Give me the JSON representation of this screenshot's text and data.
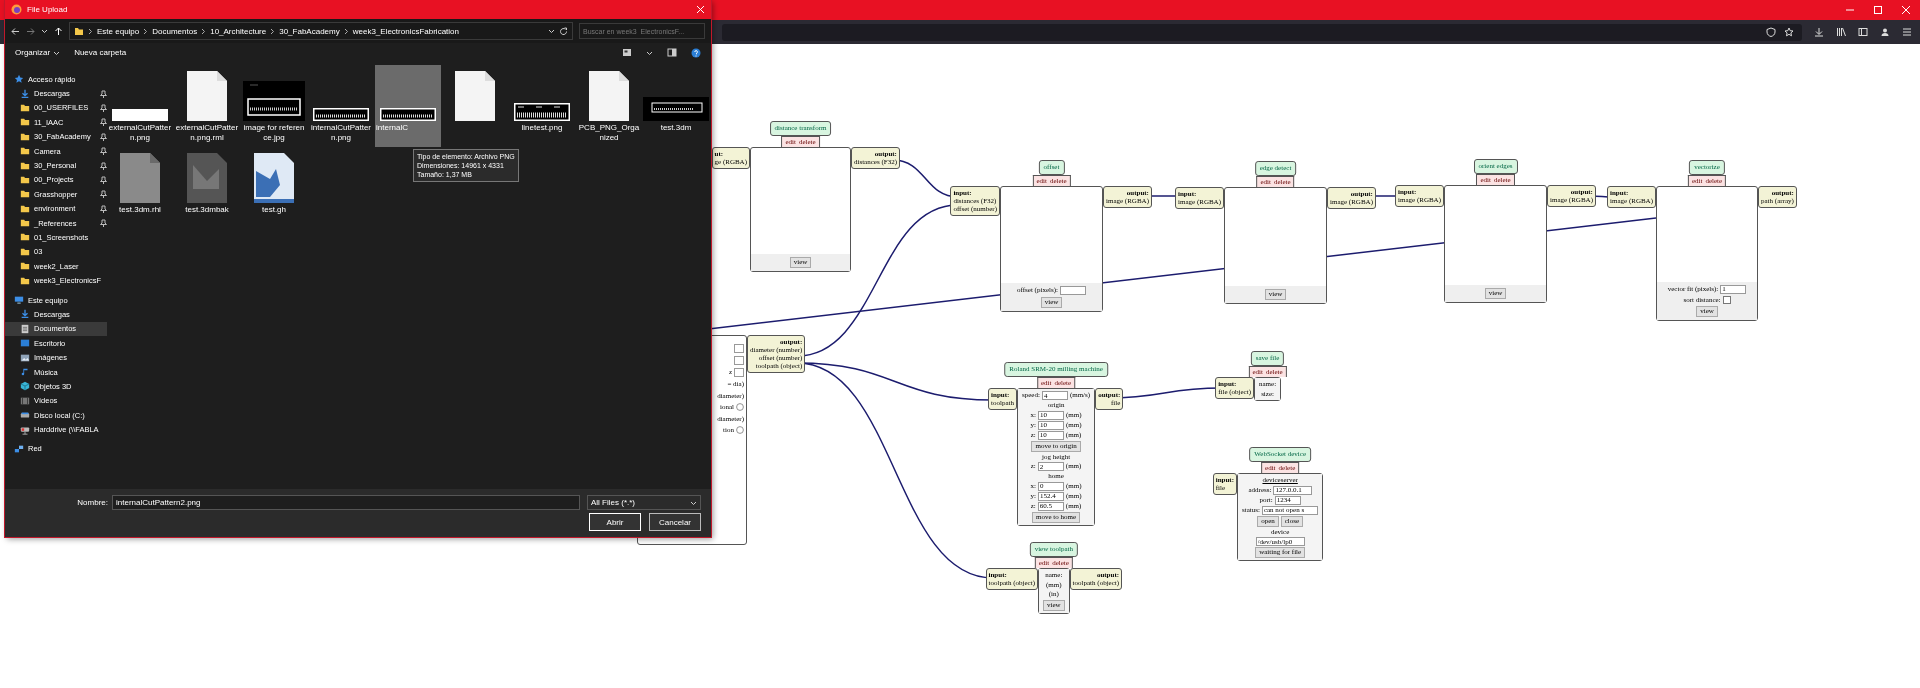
{
  "dialog": {
    "title": "File Upload",
    "breadcrumbs": [
      "Este equipo",
      "Documentos",
      "10_Architecture",
      "30_FabAcademy",
      "week3_ElectronicsFabrication"
    ],
    "search": {
      "placeholder": "Buscar en week3_ElectronicsF..."
    },
    "toolbar": {
      "organize": "Organizar",
      "new_folder": "Nueva carpeta"
    },
    "sidebar": [
      {
        "label": "Acceso rápido",
        "kind": "star",
        "selected": false,
        "items": [
          {
            "label": "Descargas",
            "kind": "download",
            "pinned": true,
            "selected": false
          },
          {
            "label": "00_USERFILES",
            "kind": "folder",
            "pinned": true,
            "selected": false
          },
          {
            "label": "11_IAAC",
            "kind": "folder",
            "pinned": true,
            "selected": false
          },
          {
            "label": "30_FabAcademy",
            "kind": "folder",
            "pinned": true,
            "selected": false
          },
          {
            "label": "Camera",
            "kind": "folder",
            "pinned": true,
            "selected": false
          },
          {
            "label": "30_Personal",
            "kind": "folder",
            "pinned": true,
            "selected": false
          },
          {
            "label": "00_Projects",
            "kind": "folder",
            "pinned": true,
            "selected": false
          },
          {
            "label": "Grasshopper",
            "kind": "folder",
            "pinned": true,
            "selected": false
          },
          {
            "label": "environment",
            "kind": "folder",
            "pinned": true,
            "selected": false
          },
          {
            "label": "_References",
            "kind": "folder",
            "pinned": true,
            "selected": false
          },
          {
            "label": "01_Screenshots",
            "kind": "folder",
            "pinned": false,
            "selected": false
          },
          {
            "label": "03",
            "kind": "folder",
            "pinned": false,
            "selected": false
          },
          {
            "label": "week2_Laser",
            "kind": "folder",
            "pinned": false,
            "selected": false
          },
          {
            "label": "week3_ElectronicsF",
            "kind": "folder",
            "pinned": false,
            "selected": false
          }
        ]
      },
      {
        "label": "Este equipo",
        "kind": "pc",
        "selected": false,
        "items": [
          {
            "label": "Descargas",
            "kind": "download",
            "selected": false
          },
          {
            "label": "Documentos",
            "kind": "documents",
            "selected": true
          },
          {
            "label": "Escritorio",
            "kind": "desktop",
            "selected": false
          },
          {
            "label": "Imágenes",
            "kind": "pictures",
            "selected": false
          },
          {
            "label": "Música",
            "kind": "music",
            "selected": false
          },
          {
            "label": "Objetos 3D",
            "kind": "objects",
            "selected": false
          },
          {
            "label": "Vídeos",
            "kind": "videos",
            "selected": false
          },
          {
            "label": "Disco local (C:)",
            "kind": "disk",
            "selected": false
          },
          {
            "label": "Harddrive (\\\\FABLA",
            "kind": "netdrive",
            "selected": false
          }
        ]
      },
      {
        "label": "Red",
        "kind": "network",
        "selected": false
      }
    ],
    "files": [
      {
        "label": "externalCutPattern.png",
        "kind": "white-strip",
        "selected": false
      },
      {
        "label": "externalCutPattern.png.rml",
        "kind": "document",
        "selected": false
      },
      {
        "label": "image for reference.jpg",
        "kind": "dark-photo",
        "selected": false
      },
      {
        "label": "internalCutPattern.png",
        "kind": "pattern",
        "selected": false
      },
      {
        "label": "internalC",
        "kind": "pattern",
        "selected": true
      },
      {
        "kind": "document",
        "selected": false
      },
      {
        "label": "linetest.png",
        "kind": "pattern-tall",
        "selected": false
      },
      {
        "label": "PCB_PNG_Organized",
        "kind": "document",
        "selected": false
      },
      {
        "label": "test.3dm",
        "kind": "dark-pattern",
        "selected": false
      },
      {
        "label": "test.3dm.rhl",
        "kind": "grey-document",
        "selected": false
      },
      {
        "label": "test.3dmbak",
        "kind": "grey-image",
        "selected": false
      },
      {
        "label": "test.gh",
        "kind": "blue-image",
        "selected": false
      }
    ],
    "tooltip": [
      "Tipo de elemento: Archivo PNG",
      "Dimensiones: 14961 x 4331",
      "Tamaño: 1,37 MB"
    ],
    "filename": {
      "label": "Nombre:",
      "value": "internalCutPattern2.png"
    },
    "filter": "All Files (*.*)",
    "buttons": [
      "Abrir",
      "Cancelar"
    ]
  },
  "nodes": [
    {
      "title": "distance transform",
      "kind": "image",
      "actions": [
        "edit",
        "delete"
      ],
      "input": {
        "label": "ut:",
        "ports": [
          "ge (RGBA)"
        ]
      },
      "output": {
        "label": "output:",
        "ports": [
          "distances (F32)"
        ]
      },
      "controls": [
        {
          "kind": "button",
          "label": "view"
        }
      ]
    },
    {
      "title": "offset",
      "kind": "image",
      "actions": [
        "edit",
        "delete"
      ],
      "input": {
        "label": "input:",
        "ports": [
          "distances (F32)",
          "offset (number)"
        ]
      },
      "output": {
        "label": "output:",
        "ports": [
          "image (RGBA)"
        ]
      },
      "controls": [
        {
          "kind": "field",
          "label": "offset (pixels):"
        },
        {
          "kind": "button",
          "label": "view"
        }
      ]
    },
    {
      "title": "edge detect",
      "kind": "image",
      "actions": [
        "edit",
        "delete"
      ],
      "input": {
        "label": "input:",
        "ports": [
          "image (RGBA)"
        ]
      },
      "output": {
        "label": "output:",
        "ports": [
          "image (RGBA)"
        ]
      },
      "controls": [
        {
          "kind": "button",
          "label": "view"
        }
      ]
    },
    {
      "title": "orient edges",
      "kind": "image",
      "actions": [
        "edit",
        "delete"
      ],
      "input": {
        "label": "input:",
        "ports": [
          "image (RGBA)"
        ]
      },
      "output": {
        "label": "output:",
        "ports": [
          "image (RGBA)"
        ]
      },
      "controls": [
        {
          "kind": "button",
          "label": "view"
        }
      ]
    },
    {
      "title": "vectorize",
      "kind": "image",
      "actions": [
        "edit",
        "delete"
      ],
      "input": {
        "label": "input:",
        "ports": [
          "image (RGBA)"
        ]
      },
      "output": {
        "label": "output:",
        "ports": [
          "path (array)"
        ]
      },
      "controls": [
        {
          "kind": "field",
          "label": "vector fit (pixels):",
          "value": "1"
        },
        {
          "kind": "checkbox",
          "label": "sort distance:",
          "checked": false
        },
        {
          "kind": "button",
          "label": "view"
        }
      ]
    },
    {
      "kind": "partial",
      "output": {
        "label": "output:",
        "ports": [
          "diameter (number)",
          "offset (number)",
          "toolpath (object)"
        ]
      },
      "controls": [
        {
          "kind": "field"
        },
        {
          "kind": "field"
        },
        {
          "kind": "field",
          "label": "z"
        },
        {
          "kind": "text",
          "label": "= dia)"
        },
        {
          "kind": "text",
          "label": "diameter)"
        },
        {
          "kind": "radio",
          "label": "ional",
          "checked": false
        },
        {
          "kind": "text",
          "label": "diameter)"
        },
        {
          "kind": "radio",
          "label": "tion",
          "checked": false
        }
      ]
    },
    {
      "title": "Roland SRM-20 milling machine",
      "kind": "panel",
      "actions": [
        "edit",
        "delete"
      ],
      "input": {
        "label": "input:",
        "ports": [
          "toolpath"
        ]
      },
      "output": {
        "label": "output:",
        "ports": [
          "file"
        ]
      },
      "controls": [
        {
          "kind": "field",
          "label": "speed:",
          "value": "4",
          "unit": "(mm/s)"
        },
        {
          "kind": "text",
          "label": "origin"
        },
        {
          "kind": "field",
          "label": "x:",
          "value": "10",
          "unit": "(mm)"
        },
        {
          "kind": "field",
          "label": "y:",
          "value": "10",
          "unit": "(mm)"
        },
        {
          "kind": "field",
          "label": "z:",
          "value": "10",
          "unit": "(mm)"
        },
        {
          "kind": "button",
          "label": "move to origin"
        },
        {
          "kind": "text",
          "label": "jog height"
        },
        {
          "kind": "field",
          "label": "z:",
          "value": "2",
          "unit": "(mm)"
        },
        {
          "kind": "text",
          "label": "home"
        },
        {
          "kind": "field",
          "label": "x:",
          "value": "0",
          "unit": "(mm)"
        },
        {
          "kind": "field",
          "label": "y:",
          "value": "152.4",
          "unit": "(mm)"
        },
        {
          "kind": "field",
          "label": "z:",
          "value": "60.5",
          "unit": "(mm)"
        },
        {
          "kind": "button",
          "label": "move to home"
        }
      ]
    },
    {
      "title": "save file",
      "kind": "panel",
      "actions": [
        "edit",
        "delete"
      ],
      "input": {
        "label": "input:",
        "ports": [
          "file (object)"
        ]
      },
      "controls": [
        {
          "kind": "text",
          "label": "name:"
        },
        {
          "kind": "text",
          "label": "size:"
        }
      ]
    },
    {
      "title": "WebSocket device",
      "kind": "panel",
      "actions": [
        "edit",
        "delete"
      ],
      "input": {
        "label": "input:",
        "ports": [
          "file"
        ]
      },
      "controls": [
        {
          "kind": "link",
          "label": "deviceserver"
        },
        {
          "kind": "field",
          "label": "address:",
          "value": "127.0.0.1"
        },
        {
          "kind": "field",
          "label": "port:",
          "value": "1234"
        },
        {
          "kind": "field",
          "label": "status:",
          "value": "can not open s"
        },
        {
          "kind": "button_row",
          "labels": [
            "open",
            "close"
          ]
        },
        {
          "kind": "text",
          "label": "device"
        },
        {
          "kind": "field",
          "value": "/dev/usb/lp0"
        },
        {
          "kind": "button",
          "label": "waiting for file"
        }
      ]
    },
    {
      "title": "view toolpath",
      "kind": "panel",
      "actions": [
        "edit",
        "delete"
      ],
      "input": {
        "label": "input:",
        "ports": [
          "toolpath (object)"
        ]
      },
      "output": {
        "label": "output:",
        "ports": [
          "toolpath (object)"
        ]
      },
      "controls": [
        {
          "kind": "text",
          "label": "name:"
        },
        {
          "kind": "text",
          "label": "(mm)"
        },
        {
          "kind": "text",
          "label": "(in)"
        },
        {
          "kind": "button",
          "label": "view"
        }
      ]
    }
  ]
}
